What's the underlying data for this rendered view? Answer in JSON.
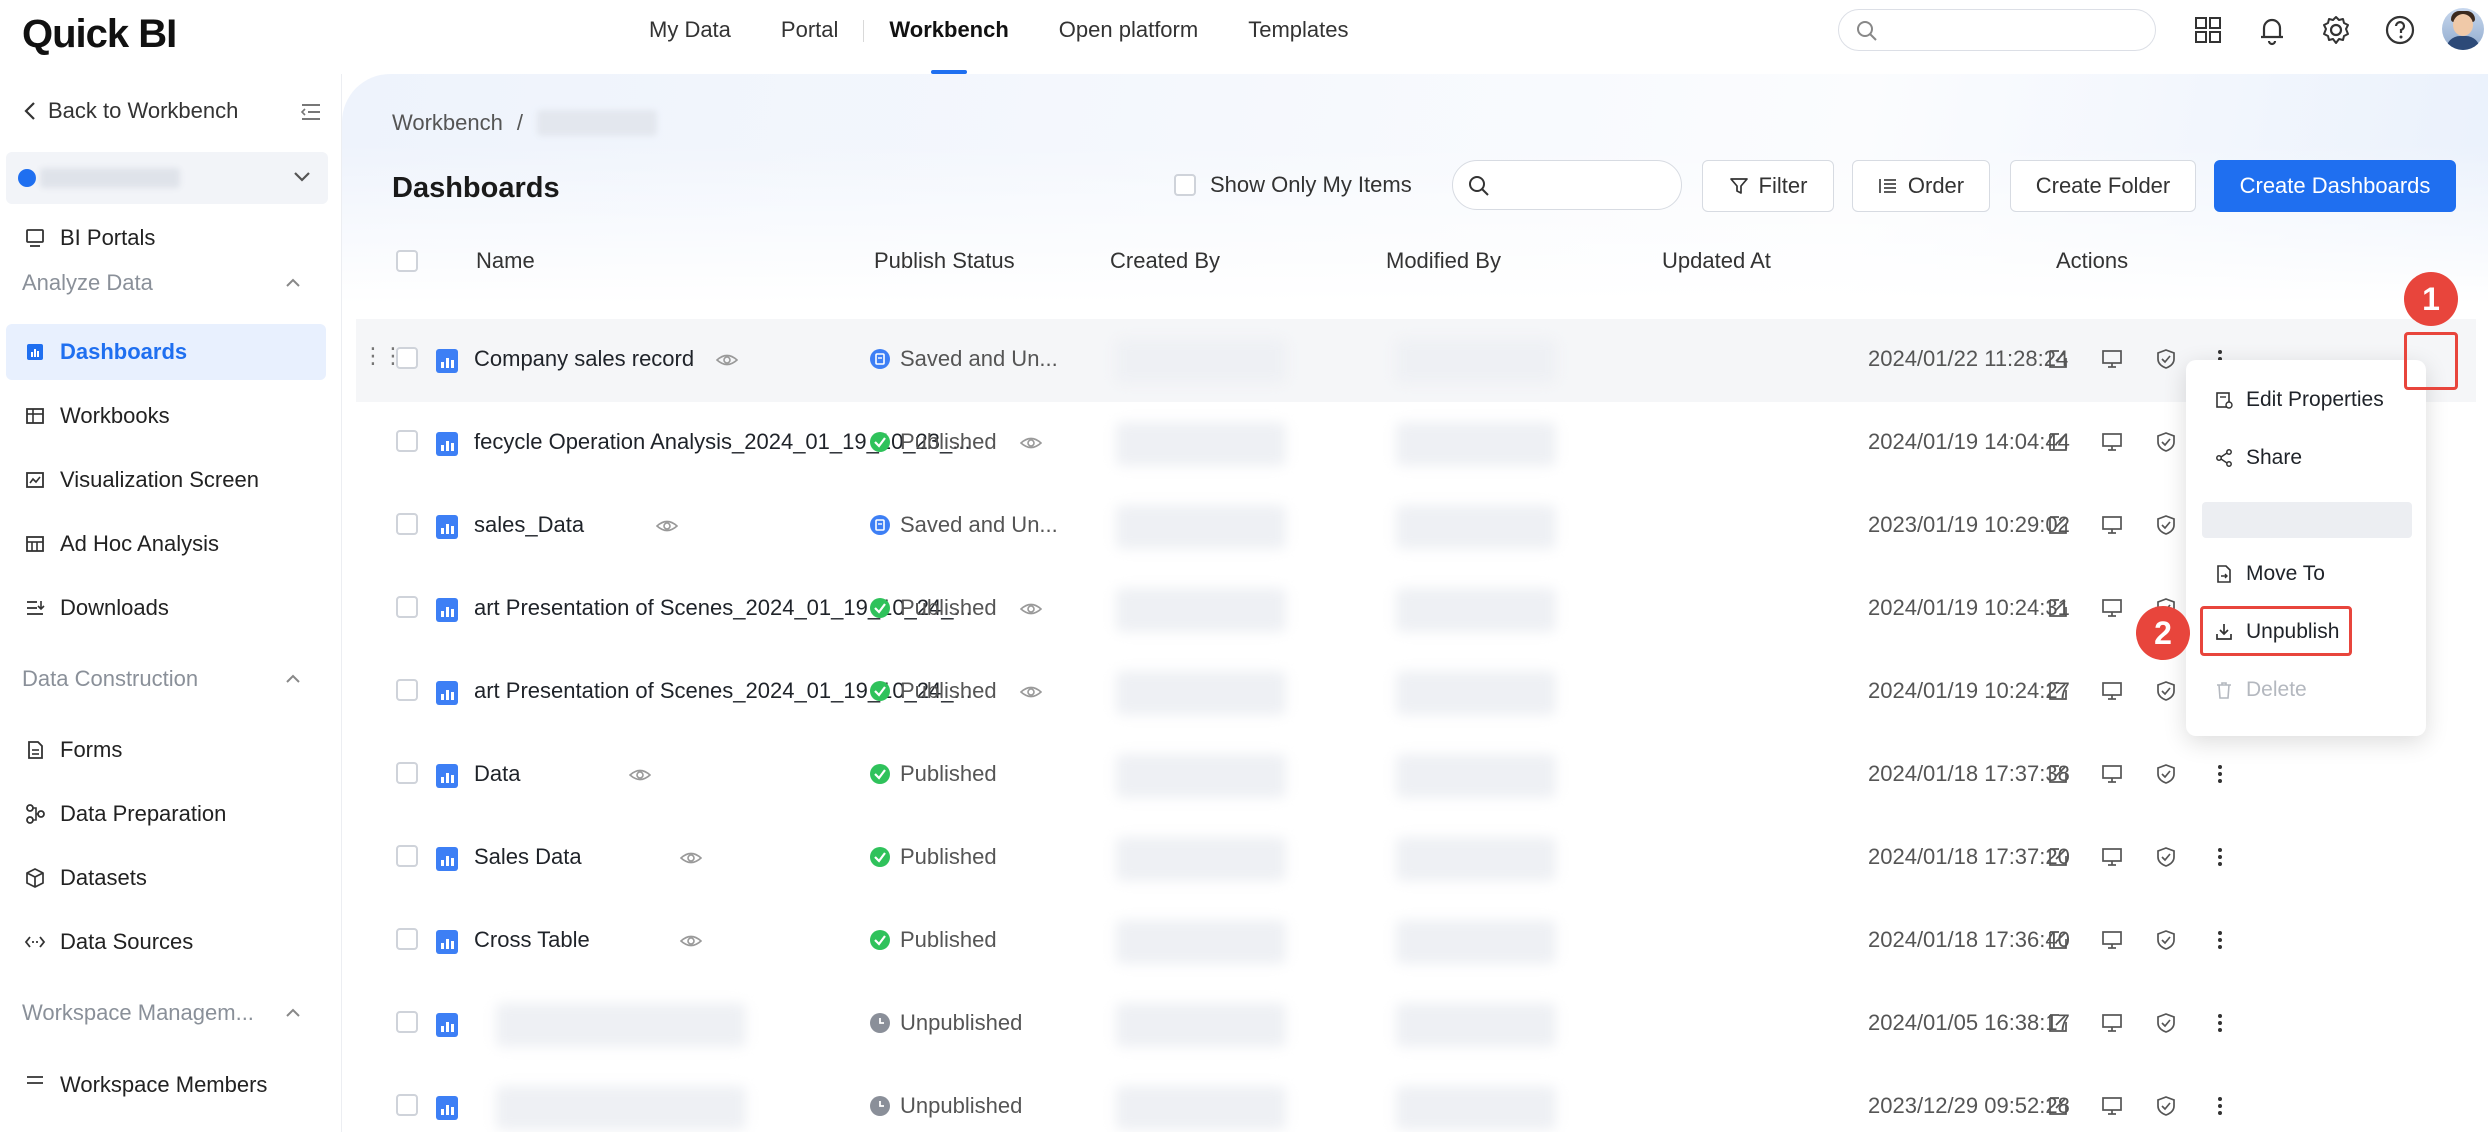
{
  "app": {
    "logo": "Quick BI"
  },
  "nav": {
    "items": [
      {
        "label": "My Data"
      },
      {
        "label": "Portal"
      },
      {
        "label": "Workbench"
      },
      {
        "label": "Open platform"
      },
      {
        "label": "Templates"
      }
    ],
    "active": "Workbench"
  },
  "sidebar": {
    "back_label": "Back to Workbench",
    "portals_label": "BI Portals",
    "groups": [
      {
        "label": "Analyze Data",
        "items": [
          "Dashboards",
          "Workbooks",
          "Visualization Screen",
          "Ad Hoc Analysis",
          "Downloads"
        ]
      },
      {
        "label": "Data Construction",
        "items": [
          "Forms",
          "Data Preparation",
          "Datasets",
          "Data Sources"
        ]
      },
      {
        "label": "Workspace Managem...",
        "items": [
          "Workspace Members"
        ]
      }
    ],
    "active_item": "Dashboards"
  },
  "page": {
    "breadcrumb_root": "Workbench",
    "breadcrumb_sep": "/",
    "title": "Dashboards"
  },
  "toolbar": {
    "show_mine_label": "Show Only My Items",
    "filter_label": "Filter",
    "order_label": "Order",
    "create_folder_label": "Create Folder",
    "create_dashboards_label": "Create Dashboards"
  },
  "table": {
    "columns": [
      "Name",
      "Publish Status",
      "Created By",
      "Modified By",
      "Updated At",
      "Actions"
    ],
    "rows": [
      {
        "name": "Company sales record",
        "status": "Saved and Un...",
        "status_type": "saved",
        "updated": "2024/01/22 11:28:24"
      },
      {
        "name": "fecycle Operation Analysis_2024_01_19_10_23_...",
        "status": "Published",
        "status_type": "published",
        "updated": "2024/01/19 14:04:44"
      },
      {
        "name": "sales_Data",
        "status": "Saved and Un...",
        "status_type": "saved",
        "updated": "2023/01/19 10:29:02"
      },
      {
        "name": "art Presentation of Scenes_2024_01_19_10_24_...",
        "status": "Published",
        "status_type": "published",
        "updated": "2024/01/19 10:24:31"
      },
      {
        "name": "art Presentation of Scenes_2024_01_19_10_24_...",
        "status": "Published",
        "status_type": "published",
        "updated": "2024/01/19 10:24:27"
      },
      {
        "name": "Data",
        "status": "Published",
        "status_type": "published",
        "updated": "2024/01/18 17:37:38"
      },
      {
        "name": "Sales Data",
        "status": "Published",
        "status_type": "published",
        "updated": "2024/01/18 17:37:20"
      },
      {
        "name": "Cross Table",
        "status": "Published",
        "status_type": "published",
        "updated": "2024/01/18 17:36:40"
      },
      {
        "name": "",
        "status": "Unpublished",
        "status_type": "unpublished",
        "updated": "2024/01/05 16:38:17"
      },
      {
        "name": "",
        "status": "Unpublished",
        "status_type": "unpublished",
        "updated": "2023/12/29 09:52:28"
      }
    ]
  },
  "menu": {
    "items": [
      {
        "label": "Edit Properties",
        "icon": "edit-properties-icon",
        "disabled": false
      },
      {
        "label": "Share",
        "icon": "share-icon",
        "disabled": false
      },
      {
        "label": "Move To",
        "icon": "move-to-icon",
        "disabled": false
      },
      {
        "label": "Unpublish",
        "icon": "unpublish-icon",
        "disabled": false
      },
      {
        "label": "Delete",
        "icon": "trash-icon",
        "disabled": true
      }
    ]
  },
  "annotations": {
    "step1": "1",
    "step2": "2"
  },
  "colors": {
    "accent": "#1f6ff0",
    "published": "#2fc25b",
    "saved": "#3d7ff5",
    "unpublished": "#8a8f99",
    "highlight": "#e8453c"
  }
}
